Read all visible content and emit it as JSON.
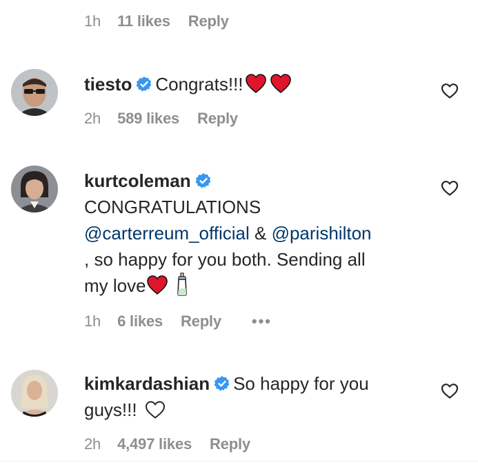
{
  "top_meta": {
    "time": "1h",
    "likes": "11 likes",
    "reply": "Reply"
  },
  "comments": [
    {
      "username": "tiesto",
      "text": "Congrats!!!",
      "time": "2h",
      "likes": "589 likes",
      "reply": "Reply"
    },
    {
      "username": "kurtcoleman",
      "line1": "CONGRATULATIONS",
      "mention1": "@carterreum_official",
      "amp": " & ",
      "mention2": "@parishilton",
      "line3": ", so happy for you both. Sending all",
      "line4": "my love",
      "time": "1h",
      "likes": "6 likes",
      "reply": "Reply",
      "more": "•••"
    },
    {
      "username": "kimkardashian",
      "text_line1": "So happy for you",
      "text_line2": "guys!!!",
      "time": "2h",
      "likes": "4,497 likes",
      "reply": "Reply"
    }
  ],
  "colors": {
    "verified": "#3897f0",
    "heart_emoji": "#e0152c",
    "muted": "#8e8e8e",
    "mention": "#00376b"
  },
  "icons": [
    "verified-badge-icon",
    "heart-emoji-icon",
    "like-heart-icon",
    "baby-bottle-icon",
    "white-heart-icon",
    "more-options-icon"
  ]
}
